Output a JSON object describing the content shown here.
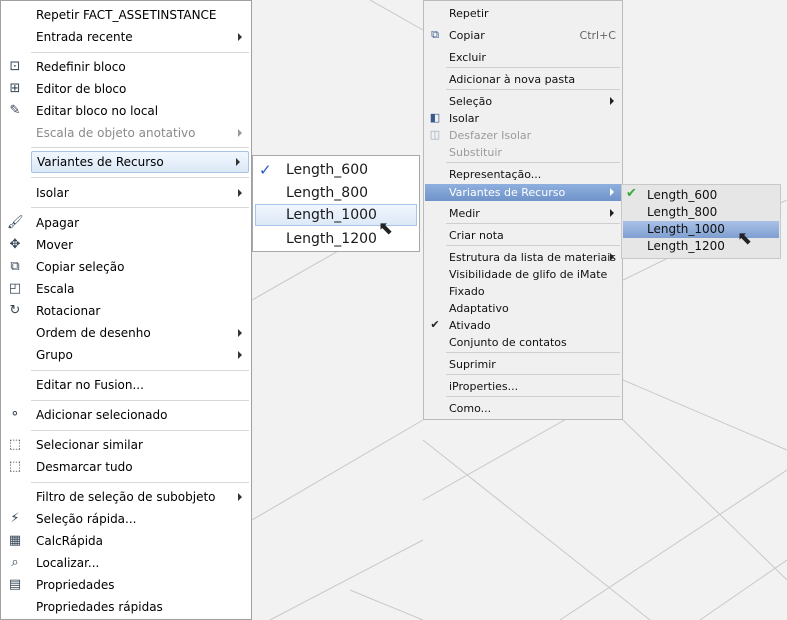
{
  "menu_a": {
    "items": [
      {
        "label": "Repetir FACT_ASSETINSTANCE",
        "icon": "",
        "arrow": false,
        "disabled": false
      },
      {
        "label": "Entrada recente",
        "icon": "",
        "arrow": true,
        "disabled": false
      },
      {
        "label": "Redefinir bloco",
        "icon": "redefine-block-icon",
        "arrow": false,
        "disabled": false
      },
      {
        "label": "Editor de bloco",
        "icon": "block-editor-icon",
        "arrow": false,
        "disabled": false
      },
      {
        "label": "Editar bloco no local",
        "icon": "edit-block-inplace-icon",
        "arrow": false,
        "disabled": false
      },
      {
        "label": "Escala de objeto anotativo",
        "icon": "",
        "arrow": true,
        "disabled": true
      },
      {
        "label": "Variantes de Recurso",
        "icon": "",
        "arrow": true,
        "disabled": false,
        "highlighted": true
      },
      {
        "label": "Isolar",
        "icon": "",
        "arrow": true,
        "disabled": false
      },
      {
        "label": "Apagar",
        "icon": "erase-icon",
        "arrow": false,
        "disabled": false
      },
      {
        "label": "Mover",
        "icon": "move-icon",
        "arrow": false,
        "disabled": false
      },
      {
        "label": "Copiar seleção",
        "icon": "copy-selection-icon",
        "arrow": false,
        "disabled": false
      },
      {
        "label": "Escala",
        "icon": "scale-icon",
        "arrow": false,
        "disabled": false
      },
      {
        "label": "Rotacionar",
        "icon": "rotate-icon",
        "arrow": false,
        "disabled": false
      },
      {
        "label": "Ordem de desenho",
        "icon": "",
        "arrow": true,
        "disabled": false
      },
      {
        "label": "Grupo",
        "icon": "",
        "arrow": true,
        "disabled": false
      },
      {
        "label": "Editar no Fusion...",
        "icon": "",
        "arrow": false,
        "disabled": false
      },
      {
        "label": "Adicionar selecionado",
        "icon": "add-selected-icon",
        "arrow": false,
        "disabled": false
      },
      {
        "label": "Selecionar similar",
        "icon": "select-similar-icon",
        "arrow": false,
        "disabled": false
      },
      {
        "label": "Desmarcar tudo",
        "icon": "deselect-all-icon",
        "arrow": false,
        "disabled": false
      },
      {
        "label": "Filtro de seleção de subobjeto",
        "icon": "",
        "arrow": true,
        "disabled": false
      },
      {
        "label": "Seleção rápida...",
        "icon": "quick-select-icon",
        "arrow": false,
        "disabled": false
      },
      {
        "label": "CalcRápida",
        "icon": "quick-calc-icon",
        "arrow": false,
        "disabled": false
      },
      {
        "label": "Localizar...",
        "icon": "find-icon",
        "arrow": false,
        "disabled": false
      },
      {
        "label": "Propriedades",
        "icon": "properties-icon",
        "arrow": false,
        "disabled": false
      },
      {
        "label": "Propriedades rápidas",
        "icon": "",
        "arrow": false,
        "disabled": false
      }
    ],
    "submenu": [
      {
        "label": "Length_600",
        "checked": true,
        "highlighted": false
      },
      {
        "label": "Length_800",
        "checked": false,
        "highlighted": false
      },
      {
        "label": "Length_1000",
        "checked": false,
        "highlighted": true
      },
      {
        "label": "Length_1200",
        "checked": false,
        "highlighted": false
      }
    ]
  },
  "menu_b": {
    "items": [
      {
        "label": "Repetir",
        "arrow": false,
        "disabled": false,
        "icon": ""
      },
      {
        "label": "Copiar",
        "shortcut": "Ctrl+C",
        "arrow": false,
        "disabled": false,
        "icon": "copy-icon"
      },
      {
        "label": "Excluir",
        "arrow": false,
        "disabled": false,
        "icon": ""
      },
      {
        "label": "Adicionar à nova pasta",
        "arrow": false,
        "disabled": false,
        "icon": ""
      },
      {
        "label": "Seleção",
        "arrow": true,
        "disabled": false,
        "icon": ""
      },
      {
        "label": "Isolar",
        "arrow": false,
        "disabled": false,
        "icon": "isolate-icon"
      },
      {
        "label": "Desfazer Isolar",
        "arrow": false,
        "disabled": true,
        "icon": "undo-isolate-icon"
      },
      {
        "label": "Substituir",
        "arrow": false,
        "disabled": true,
        "icon": ""
      },
      {
        "label": "Representação...",
        "arrow": false,
        "disabled": false,
        "icon": ""
      },
      {
        "label": "Variantes de Recurso",
        "arrow": true,
        "disabled": false,
        "icon": "",
        "highlighted": true
      },
      {
        "label": "Medir",
        "arrow": true,
        "disabled": false,
        "icon": ""
      },
      {
        "label": "Criar nota",
        "arrow": false,
        "disabled": false,
        "icon": ""
      },
      {
        "label": "Estrutura da lista de materiais",
        "arrow": true,
        "disabled": false,
        "icon": ""
      },
      {
        "label": "Visibilidade de glifo de iMate",
        "arrow": false,
        "disabled": false,
        "icon": ""
      },
      {
        "label": "Fixado",
        "arrow": false,
        "disabled": false,
        "icon": ""
      },
      {
        "label": "Adaptativo",
        "arrow": false,
        "disabled": false,
        "icon": ""
      },
      {
        "label": "Ativado",
        "arrow": false,
        "disabled": false,
        "icon": "check-icon"
      },
      {
        "label": "Conjunto de contatos",
        "arrow": false,
        "disabled": false,
        "icon": ""
      },
      {
        "label": "Suprimir",
        "arrow": false,
        "disabled": false,
        "icon": ""
      },
      {
        "label": "iProperties...",
        "arrow": false,
        "disabled": false,
        "icon": ""
      },
      {
        "label": "Como...",
        "arrow": false,
        "disabled": false,
        "icon": ""
      }
    ],
    "submenu": [
      {
        "label": "Length_600",
        "checked": true,
        "highlighted": false
      },
      {
        "label": "Length_800",
        "checked": false,
        "highlighted": false
      },
      {
        "label": "Length_1000",
        "checked": false,
        "highlighted": true
      },
      {
        "label": "Length_1200",
        "checked": false,
        "highlighted": false
      }
    ]
  }
}
